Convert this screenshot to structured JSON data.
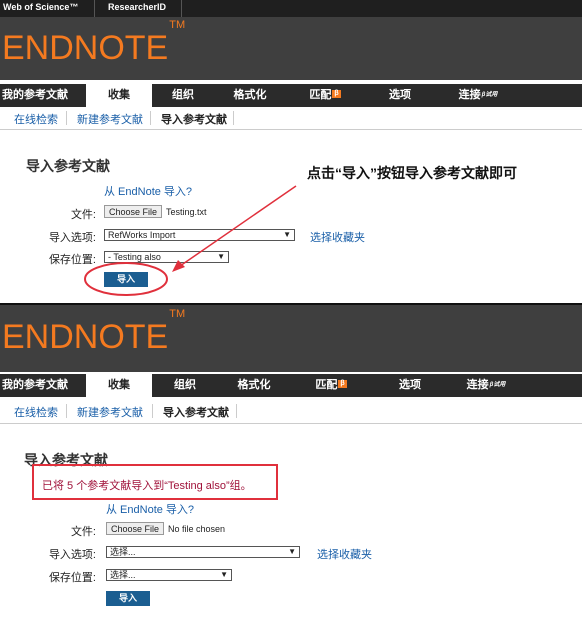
{
  "topbar": {
    "links": [
      "Web of Science™",
      "ResearcherID"
    ]
  },
  "logo": {
    "text": "ENDNOTE",
    "tm": "TM"
  },
  "nav": {
    "items": [
      "我的参考文献",
      "收集",
      "组织",
      "格式化",
      "匹配",
      "选项",
      "连接"
    ],
    "badge": "β",
    "sup": "β试用"
  },
  "subnav": {
    "items": [
      "在线检索",
      "新建参考文献",
      "导入参考文献"
    ]
  },
  "panel1": {
    "title": "导入参考文献",
    "from_link": "从 EndNote 导入?",
    "file_label": "文件:",
    "choose_file": "Choose File",
    "file_name": "Testing.txt",
    "import_option_label": "导入选项:",
    "import_option_value": "RefWorks Import",
    "choose_fav": "选择收藏夹",
    "save_label": "保存位置:",
    "save_value": "- Testing also",
    "import_button": "导入"
  },
  "annotation": "点击“导入”按钮导入参考文献即可",
  "panel2": {
    "title": "导入参考文献",
    "success_msg": "已将 5 个参考文献导入到“Testing also”组。",
    "from_link": "从 EndNote 导入?",
    "file_label": "文件:",
    "choose_file": "Choose File",
    "file_name": "No file chosen",
    "import_option_label": "导入选项:",
    "import_option_value": "选择...",
    "choose_fav": "选择收藏夹",
    "save_label": "保存位置:",
    "save_value": "选择...",
    "import_button": "导入"
  },
  "colors": {
    "accent": "#f47a20",
    "link": "#1a5fa8",
    "button": "#1b5e91",
    "highlight": "#e0303c"
  }
}
